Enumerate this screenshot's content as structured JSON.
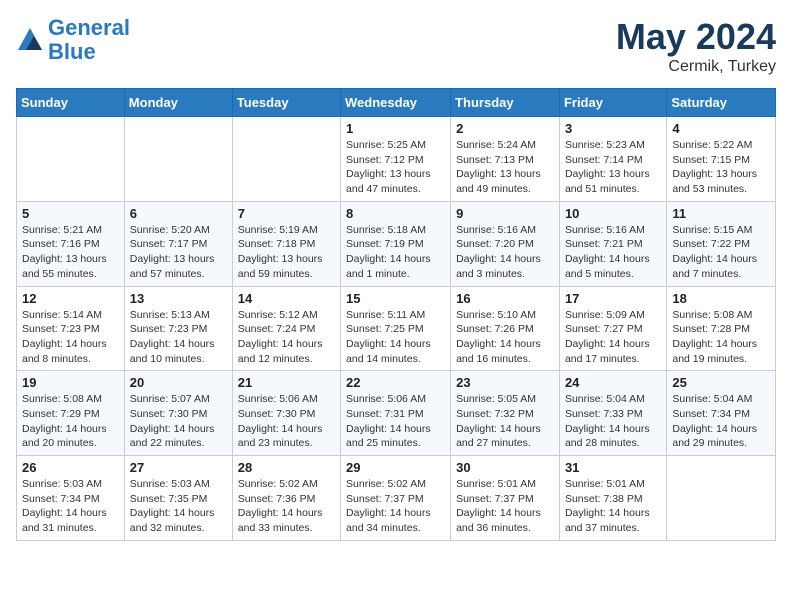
{
  "header": {
    "logo_line1": "General",
    "logo_line2": "Blue",
    "month": "May 2024",
    "location": "Cermik, Turkey"
  },
  "weekdays": [
    "Sunday",
    "Monday",
    "Tuesday",
    "Wednesday",
    "Thursday",
    "Friday",
    "Saturday"
  ],
  "weeks": [
    [
      {
        "day": "",
        "sunrise": "",
        "sunset": "",
        "daylight": ""
      },
      {
        "day": "",
        "sunrise": "",
        "sunset": "",
        "daylight": ""
      },
      {
        "day": "",
        "sunrise": "",
        "sunset": "",
        "daylight": ""
      },
      {
        "day": "1",
        "sunrise": "Sunrise: 5:25 AM",
        "sunset": "Sunset: 7:12 PM",
        "daylight": "Daylight: 13 hours and 47 minutes."
      },
      {
        "day": "2",
        "sunrise": "Sunrise: 5:24 AM",
        "sunset": "Sunset: 7:13 PM",
        "daylight": "Daylight: 13 hours and 49 minutes."
      },
      {
        "day": "3",
        "sunrise": "Sunrise: 5:23 AM",
        "sunset": "Sunset: 7:14 PM",
        "daylight": "Daylight: 13 hours and 51 minutes."
      },
      {
        "day": "4",
        "sunrise": "Sunrise: 5:22 AM",
        "sunset": "Sunset: 7:15 PM",
        "daylight": "Daylight: 13 hours and 53 minutes."
      }
    ],
    [
      {
        "day": "5",
        "sunrise": "Sunrise: 5:21 AM",
        "sunset": "Sunset: 7:16 PM",
        "daylight": "Daylight: 13 hours and 55 minutes."
      },
      {
        "day": "6",
        "sunrise": "Sunrise: 5:20 AM",
        "sunset": "Sunset: 7:17 PM",
        "daylight": "Daylight: 13 hours and 57 minutes."
      },
      {
        "day": "7",
        "sunrise": "Sunrise: 5:19 AM",
        "sunset": "Sunset: 7:18 PM",
        "daylight": "Daylight: 13 hours and 59 minutes."
      },
      {
        "day": "8",
        "sunrise": "Sunrise: 5:18 AM",
        "sunset": "Sunset: 7:19 PM",
        "daylight": "Daylight: 14 hours and 1 minute."
      },
      {
        "day": "9",
        "sunrise": "Sunrise: 5:16 AM",
        "sunset": "Sunset: 7:20 PM",
        "daylight": "Daylight: 14 hours and 3 minutes."
      },
      {
        "day": "10",
        "sunrise": "Sunrise: 5:16 AM",
        "sunset": "Sunset: 7:21 PM",
        "daylight": "Daylight: 14 hours and 5 minutes."
      },
      {
        "day": "11",
        "sunrise": "Sunrise: 5:15 AM",
        "sunset": "Sunset: 7:22 PM",
        "daylight": "Daylight: 14 hours and 7 minutes."
      }
    ],
    [
      {
        "day": "12",
        "sunrise": "Sunrise: 5:14 AM",
        "sunset": "Sunset: 7:23 PM",
        "daylight": "Daylight: 14 hours and 8 minutes."
      },
      {
        "day": "13",
        "sunrise": "Sunrise: 5:13 AM",
        "sunset": "Sunset: 7:23 PM",
        "daylight": "Daylight: 14 hours and 10 minutes."
      },
      {
        "day": "14",
        "sunrise": "Sunrise: 5:12 AM",
        "sunset": "Sunset: 7:24 PM",
        "daylight": "Daylight: 14 hours and 12 minutes."
      },
      {
        "day": "15",
        "sunrise": "Sunrise: 5:11 AM",
        "sunset": "Sunset: 7:25 PM",
        "daylight": "Daylight: 14 hours and 14 minutes."
      },
      {
        "day": "16",
        "sunrise": "Sunrise: 5:10 AM",
        "sunset": "Sunset: 7:26 PM",
        "daylight": "Daylight: 14 hours and 16 minutes."
      },
      {
        "day": "17",
        "sunrise": "Sunrise: 5:09 AM",
        "sunset": "Sunset: 7:27 PM",
        "daylight": "Daylight: 14 hours and 17 minutes."
      },
      {
        "day": "18",
        "sunrise": "Sunrise: 5:08 AM",
        "sunset": "Sunset: 7:28 PM",
        "daylight": "Daylight: 14 hours and 19 minutes."
      }
    ],
    [
      {
        "day": "19",
        "sunrise": "Sunrise: 5:08 AM",
        "sunset": "Sunset: 7:29 PM",
        "daylight": "Daylight: 14 hours and 20 minutes."
      },
      {
        "day": "20",
        "sunrise": "Sunrise: 5:07 AM",
        "sunset": "Sunset: 7:30 PM",
        "daylight": "Daylight: 14 hours and 22 minutes."
      },
      {
        "day": "21",
        "sunrise": "Sunrise: 5:06 AM",
        "sunset": "Sunset: 7:30 PM",
        "daylight": "Daylight: 14 hours and 23 minutes."
      },
      {
        "day": "22",
        "sunrise": "Sunrise: 5:06 AM",
        "sunset": "Sunset: 7:31 PM",
        "daylight": "Daylight: 14 hours and 25 minutes."
      },
      {
        "day": "23",
        "sunrise": "Sunrise: 5:05 AM",
        "sunset": "Sunset: 7:32 PM",
        "daylight": "Daylight: 14 hours and 27 minutes."
      },
      {
        "day": "24",
        "sunrise": "Sunrise: 5:04 AM",
        "sunset": "Sunset: 7:33 PM",
        "daylight": "Daylight: 14 hours and 28 minutes."
      },
      {
        "day": "25",
        "sunrise": "Sunrise: 5:04 AM",
        "sunset": "Sunset: 7:34 PM",
        "daylight": "Daylight: 14 hours and 29 minutes."
      }
    ],
    [
      {
        "day": "26",
        "sunrise": "Sunrise: 5:03 AM",
        "sunset": "Sunset: 7:34 PM",
        "daylight": "Daylight: 14 hours and 31 minutes."
      },
      {
        "day": "27",
        "sunrise": "Sunrise: 5:03 AM",
        "sunset": "Sunset: 7:35 PM",
        "daylight": "Daylight: 14 hours and 32 minutes."
      },
      {
        "day": "28",
        "sunrise": "Sunrise: 5:02 AM",
        "sunset": "Sunset: 7:36 PM",
        "daylight": "Daylight: 14 hours and 33 minutes."
      },
      {
        "day": "29",
        "sunrise": "Sunrise: 5:02 AM",
        "sunset": "Sunset: 7:37 PM",
        "daylight": "Daylight: 14 hours and 34 minutes."
      },
      {
        "day": "30",
        "sunrise": "Sunrise: 5:01 AM",
        "sunset": "Sunset: 7:37 PM",
        "daylight": "Daylight: 14 hours and 36 minutes."
      },
      {
        "day": "31",
        "sunrise": "Sunrise: 5:01 AM",
        "sunset": "Sunset: 7:38 PM",
        "daylight": "Daylight: 14 hours and 37 minutes."
      },
      {
        "day": "",
        "sunrise": "",
        "sunset": "",
        "daylight": ""
      }
    ]
  ]
}
